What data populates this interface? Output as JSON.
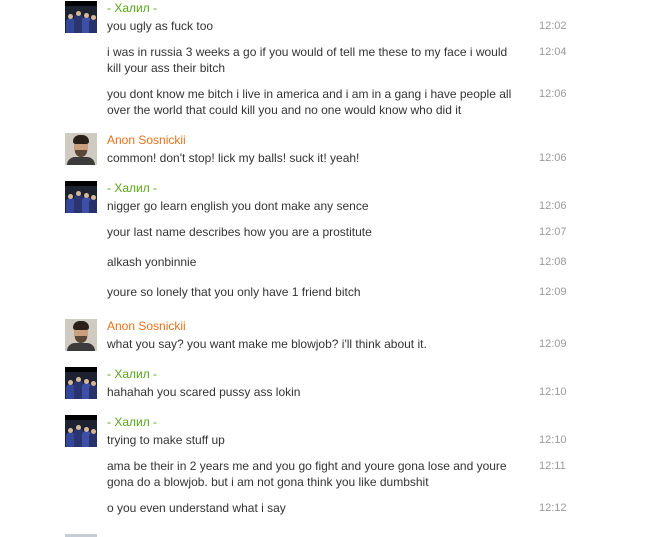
{
  "colors": {
    "sender_green": "#5aa41a",
    "sender_orange": "#e8701a",
    "time_gray": "#999999",
    "text": "#333333"
  },
  "senders": {
    "khalil": "- Халил -",
    "anon": "Anon Sosnickii"
  },
  "messages": [
    {
      "text": "you ugly as fuck too",
      "time": "12:02"
    },
    {
      "text": "i was in russia 3 weeks a go if you would of tell me these to my face i would kill your ass their bitch",
      "time": "12:04"
    },
    {
      "text": "you dont know me bitch i live in america and i am in a gang i have people all over the world that could kill you and no one would know who did it",
      "time": "12:06"
    },
    {
      "text": "common! don't stop! lick my balls! suck it! yeah!",
      "time": "12:06"
    },
    {
      "text": "nigger go learn english you dont make any sence",
      "time": "12:06"
    },
    {
      "text": "your last name describes how you are a prostitute",
      "time": "12:07"
    },
    {
      "text": "alkash yonbinnie",
      "time": "12:08"
    },
    {
      "text": "youre so lonely that you only have 1 friend bitch",
      "time": "12:09"
    },
    {
      "text": "what you say? you want make me blowjob? i'll think about it.",
      "time": "12:09"
    },
    {
      "text": "hahahah you scared pussy ass lokin",
      "time": "12:10"
    },
    {
      "text": "trying to make stuff up",
      "time": "12:10"
    },
    {
      "text": "ama be their in 2 years me and you go fight and youre gona lose and youre gona do a blowjob. but i am not gona think you like dumbshit",
      "time": "12:11"
    },
    {
      "text": "o you even understand what i say",
      "time": "12:12"
    }
  ]
}
